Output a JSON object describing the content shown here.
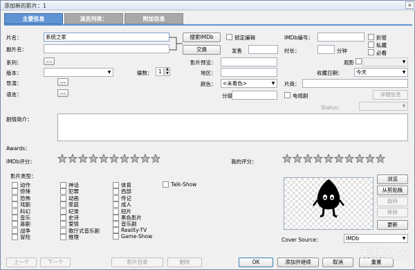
{
  "window": {
    "title": "添加新的影片：1",
    "close": "×"
  },
  "tabs": [
    "主要信息",
    "演员列表：",
    "附加信息"
  ],
  "labels": {
    "title": "片名：",
    "subtitle": "副片名：",
    "series": "系列：",
    "edition": "版本：",
    "director": "导演：",
    "language": "语言：",
    "discs": "碟数：",
    "preview": "影片预览：",
    "region": "地区：",
    "color": "颜色：",
    "rating_lvl": "分级：",
    "imdb_no": "IMDb编号：",
    "release": "发售",
    "runtime": "时长：",
    "minutes": "分钟",
    "watched": "观影",
    "collect_date": "收藏日期：",
    "vendor": "片商：",
    "status": "Status：",
    "plot": "剧情简介：",
    "awards": "Awards：",
    "imdb_rating": "IMDb评分：",
    "my_rating": "我的评分：",
    "genres": "影片类型：",
    "cover_source": "Cover Source：",
    "lock_edit": "锁定编辑",
    "tv": "电视剧"
  },
  "fields": {
    "title": "系统之家",
    "discs": "1",
    "color": "<未着色>",
    "collect_date": "今天",
    "cover_source": "IMDb"
  },
  "buttons": {
    "search_imdb": "搜索IMDb",
    "swap": "交换",
    "series_more": "...",
    "director_more": "...",
    "language_more": "...",
    "details": "详细信息",
    "browse": "浏览",
    "from_clipboard": "从剪贴板",
    "rotate": "旋转",
    "remove": "移除",
    "update": "更新",
    "prev": "上一个",
    "next": "下一个",
    "movie_catalog": "影片目录",
    "delete": "删除",
    "ok": "OK",
    "add_continue": "添加并继续",
    "cancel": "取消",
    "reset": "重置"
  },
  "flags": [
    "折屉",
    "私藏",
    "必看"
  ],
  "genres_col1": [
    "动作",
    "惊悚",
    "恐怖",
    "戏剧",
    "科幻",
    "音乐",
    "喜剧",
    "战争",
    "冒险"
  ],
  "genres_col2": [
    "神话",
    "犯罪",
    "动画",
    "家庭",
    "纪录",
    "史诗",
    "爱情",
    "歌厅式音乐剧",
    "推理"
  ],
  "genres_col3": [
    "体育",
    "西部",
    "传记",
    "成人",
    "短片",
    "黑色影片",
    "音乐剧",
    "Reality-TV",
    "Game-Show"
  ],
  "genres_col4": [
    "Talk-Show"
  ],
  "watermark": "系统之家"
}
